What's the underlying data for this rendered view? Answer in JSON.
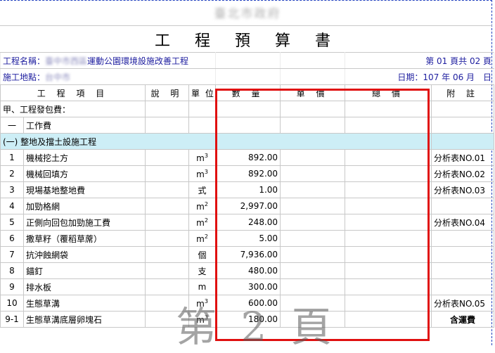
{
  "header": {
    "org": "臺北市政府",
    "title": "工 程 預 算 書",
    "project_label": "工程名稱：",
    "project_redacted": "臺中市西區",
    "project_name": "運動公園環境設施改善工程",
    "page_info": "第 01 頁共 02 頁",
    "site_label": "施工地點：",
    "site_redacted": "台中市",
    "date": "日期：107 年 06 月　日"
  },
  "columns": [
    "工 程 項 目",
    "說 明",
    "單 位",
    "數 量",
    "單 價",
    "總 價",
    "附 註"
  ],
  "rows": [
    {
      "no": "甲、工程發包費：",
      "item": "",
      "desc": "",
      "unit": "",
      "unit_sup": "",
      "qty": "",
      "note": "",
      "kind": "category"
    },
    {
      "no": "一",
      "item": "工作費",
      "desc": "",
      "unit": "",
      "unit_sup": "",
      "qty": "",
      "note": "",
      "kind": "group"
    },
    {
      "no": "(一) 整地及擋土設施工程",
      "item": "",
      "desc": "",
      "unit": "",
      "unit_sup": "",
      "qty": "",
      "note": "",
      "kind": "section"
    },
    {
      "no": "1",
      "item": "機械挖土方",
      "desc": "",
      "unit": "m",
      "unit_sup": "3",
      "qty": "892.00",
      "note": "分析表NO.01",
      "kind": "item"
    },
    {
      "no": "2",
      "item": "機械回填方",
      "desc": "",
      "unit": "m",
      "unit_sup": "3",
      "qty": "892.00",
      "note": "分析表NO.02",
      "kind": "item"
    },
    {
      "no": "3",
      "item": "現場基地整地費",
      "desc": "",
      "unit": "式",
      "unit_sup": "",
      "qty": "1.00",
      "note": "分析表NO.03",
      "kind": "item"
    },
    {
      "no": "4",
      "item": "加勁格網",
      "desc": "",
      "unit": "m",
      "unit_sup": "2",
      "qty": "2,997.00",
      "note": "",
      "kind": "item"
    },
    {
      "no": "5",
      "item": "正側向回包加勁施工費",
      "desc": "",
      "unit": "m",
      "unit_sup": "2",
      "qty": "248.00",
      "note": "分析表NO.04",
      "kind": "item"
    },
    {
      "no": "6",
      "item": "撒草籽（覆稻草蓆）",
      "desc": "",
      "unit": "m",
      "unit_sup": "2",
      "qty": "5.00",
      "note": "",
      "kind": "item"
    },
    {
      "no": "7",
      "item": "抗沖蝕網袋",
      "desc": "",
      "unit": "個",
      "unit_sup": "",
      "qty": "7,936.00",
      "note": "",
      "kind": "item"
    },
    {
      "no": "8",
      "item": "錨釘",
      "desc": "",
      "unit": "支",
      "unit_sup": "",
      "qty": "480.00",
      "note": "",
      "kind": "item"
    },
    {
      "no": "9",
      "item": "排水板",
      "desc": "",
      "unit": "m",
      "unit_sup": "",
      "qty": "300.00",
      "note": "",
      "kind": "item"
    },
    {
      "no": "10",
      "item": "生態草溝",
      "desc": "",
      "unit": "m",
      "unit_sup": "3",
      "qty": "600.00",
      "note": "分析表NO.05",
      "kind": "item"
    },
    {
      "no": "9-1",
      "item": "生態草溝底層卵塊石",
      "desc": "",
      "unit": "m",
      "unit_sup": "3",
      "qty": "180.00",
      "note": "含運費",
      "kind": "item"
    }
  ],
  "watermark": "第 2 頁",
  "colors": {
    "border": "#c8c8c8",
    "section_bg": "#cdeef6",
    "highlight": "#e01010",
    "project_text": "#2020a0"
  }
}
